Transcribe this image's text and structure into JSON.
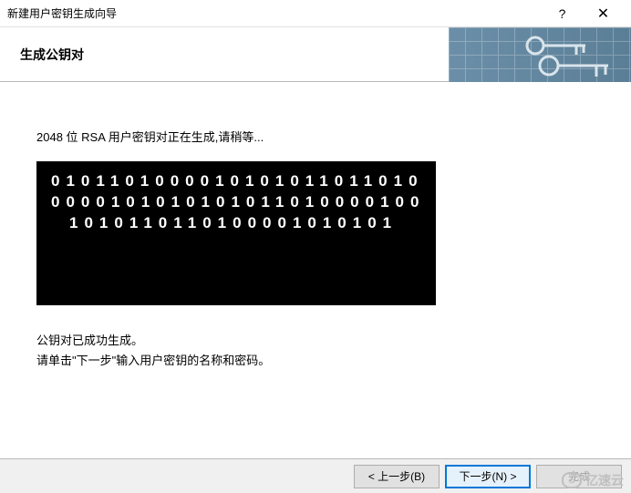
{
  "titlebar": {
    "title": "新建用户密钥生成向导"
  },
  "header": {
    "title": "生成公钥对"
  },
  "content": {
    "status": "2048 位 RSA 用户密钥对正在生成,请稍等...",
    "binary_lines": [
      "0101101000010101011011010",
      "0000101010101011010000100",
      "1010110110100001010101"
    ],
    "success_line1": "公钥对已成功生成。",
    "success_line2": "请单击\"下一步\"输入用户密钥的名称和密码。"
  },
  "footer": {
    "back": "< 上一步(B)",
    "next": "下一步(N) >",
    "finish": "完成"
  },
  "watermark": {
    "text": "亿速云"
  }
}
